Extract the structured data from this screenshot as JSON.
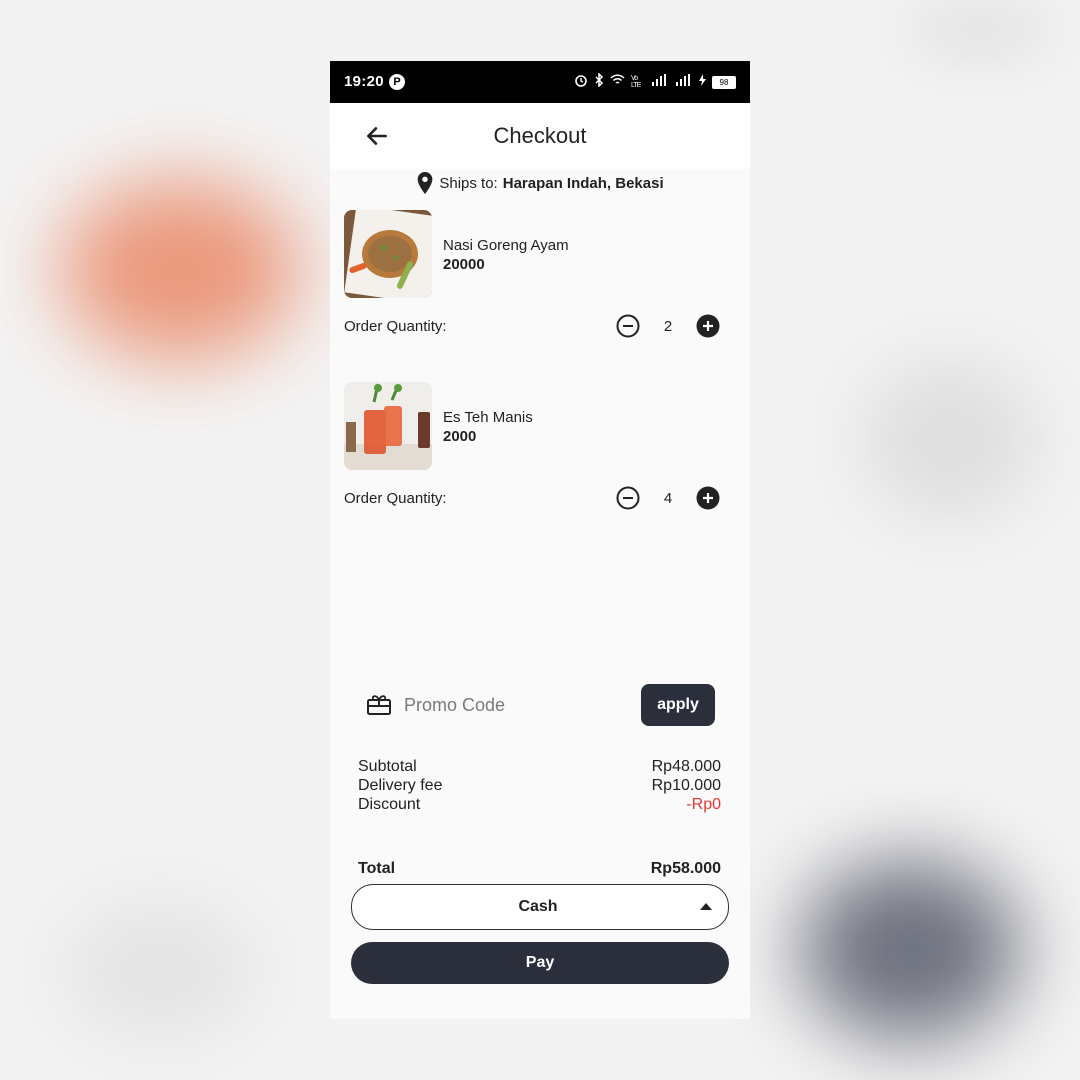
{
  "status_bar": {
    "time": "19:20",
    "app_icon": "P",
    "network": "Vo LTE",
    "battery": "98"
  },
  "header": {
    "title": "Checkout",
    "back_icon": "arrow-left-icon"
  },
  "shipping": {
    "prefix": "Ships to:",
    "address": "Harapan Indah, Bekasi"
  },
  "items": [
    {
      "name": "Nasi Goreng Ayam",
      "price": "20000",
      "qty_label": "Order Quantity:",
      "quantity": "2"
    },
    {
      "name": "Es Teh Manis",
      "price": "2000",
      "qty_label": "Order Quantity:",
      "quantity": "4"
    }
  ],
  "promo": {
    "placeholder": "Promo Code",
    "apply_label": "apply"
  },
  "summary": {
    "subtotal_label": "Subtotal",
    "subtotal_value": "Rp48.000",
    "delivery_label": "Delivery fee",
    "delivery_value": "Rp10.000",
    "discount_label": "Discount",
    "discount_value": "-Rp0",
    "total_label": "Total",
    "total_value": "Rp58.000"
  },
  "payment": {
    "selected_method": "Cash",
    "pay_label": "Pay"
  },
  "colors": {
    "primary_dark": "#2b2f3b",
    "discount_red": "#e53935",
    "background": "#fafafa"
  }
}
